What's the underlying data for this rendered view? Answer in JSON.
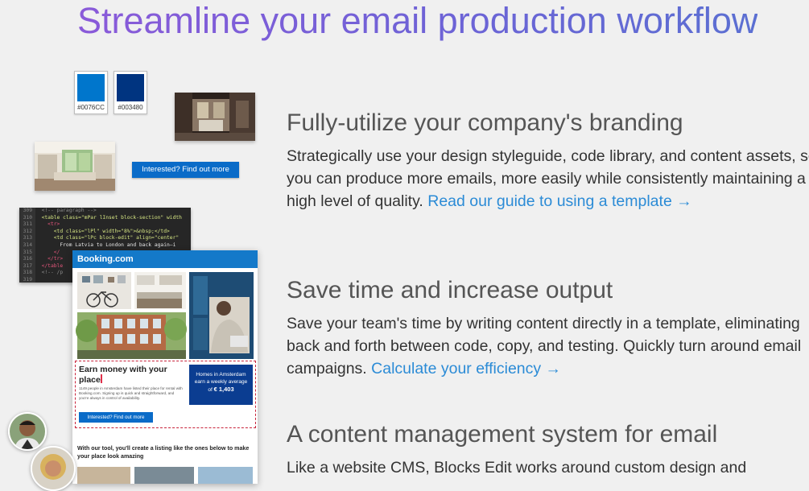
{
  "hero": {
    "title": "Streamline your email production workflow"
  },
  "swatches": [
    {
      "hex": "#0076CC",
      "label": "#0076CC"
    },
    {
      "hex": "#003480",
      "label": "#003480"
    }
  ],
  "collage": {
    "cta_label": "Interested? Find out more",
    "code_lines": [
      {
        "n": "309",
        "t": "  <!-- paragraph -->"
      },
      {
        "n": "310",
        "t": "  <table class=\"mPar lInset block-section\" width"
      },
      {
        "n": "311",
        "t": "    <tr>"
      },
      {
        "n": "312",
        "t": "      <td class=\"lPl\" width=\"8%\">&nbsp;</td>"
      },
      {
        "n": "313",
        "t": "      <td class=\"lPc block-edit\" align=\"center\""
      },
      {
        "n": "314",
        "t": "        From Latvia to London and back again—i"
      },
      {
        "n": "315",
        "t": "      </"
      },
      {
        "n": "316",
        "t": "    </tr>"
      },
      {
        "n": "317",
        "t": "  </table"
      },
      {
        "n": "318",
        "t": "  <!-- /p"
      },
      {
        "n": "319",
        "t": ""
      }
    ],
    "email": {
      "brand": "Booking.com",
      "earn_title": "Earn money with your place",
      "earn_body": "1149 people in Amsterdam have listed their place for rental with Booking.com. Signing up is quick and straightforward, and you're always in control of availability.",
      "box_line1": "Homes in Amsterdam",
      "box_line2": "earn a weekly average",
      "box_prefix": "of",
      "box_value": "€ 1,403",
      "earn_button": "Interested? Find out more",
      "tool_text": "With our tool, you'll create a listing like the ones below to make your place look amazing"
    }
  },
  "sections": [
    {
      "title": "Fully-utilize your company's branding",
      "body": "Strategically use your design styleguide, code library, and content assets, so you can produce more emails, more easily while consistently maintaining a high level of quality. ",
      "link": "Read our guide to using a template →"
    },
    {
      "title": "Save time and increase output",
      "body": "Save your team's time by writing content directly in a template, eliminating back and forth between code, copy, and testing. Quickly turn around email campaigns. ",
      "link": "Calculate your efficiency →"
    },
    {
      "title": "A content management system for email",
      "body": "Like a website CMS, Blocks Edit works around custom design and",
      "link": ""
    }
  ],
  "colors": {
    "link": "#2b8bd6",
    "button": "#0a6bc8",
    "email_header": "#1479c9",
    "highlight_border": "#c8243b"
  }
}
